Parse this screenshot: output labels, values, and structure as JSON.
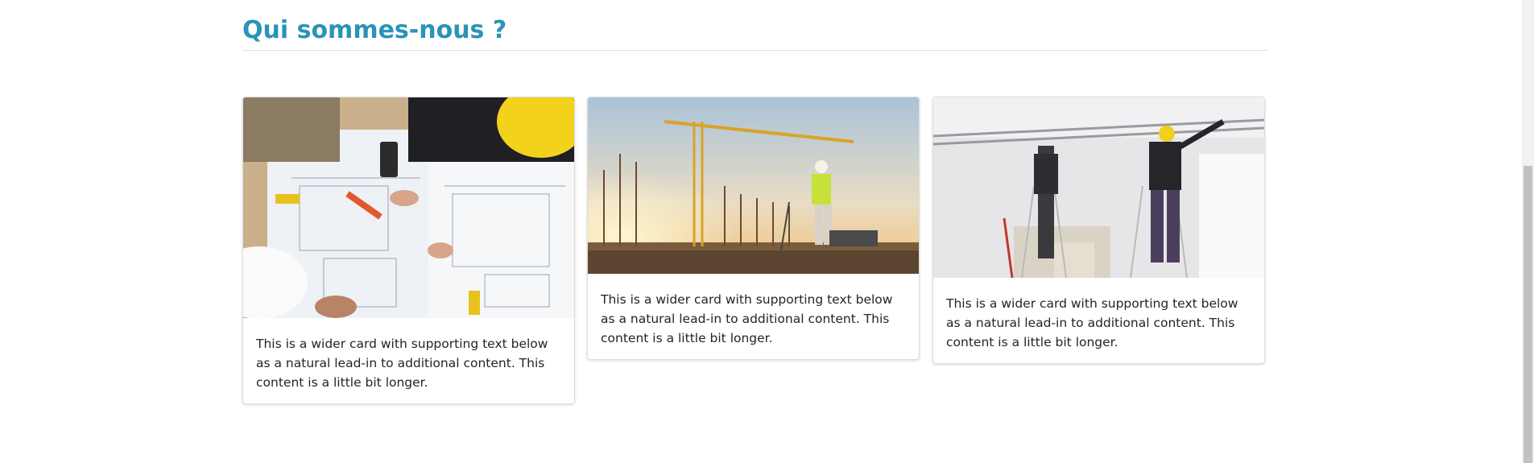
{
  "section": {
    "title": "Qui sommes-nous ?"
  },
  "cards": [
    {
      "text": "This is a wider card with supporting text below as a natural lead-in to additional content. This content is a little bit longer.",
      "image": "architects-blueprints-photo"
    },
    {
      "text": "This is a wider card with supporting text below as a natural lead-in to additional content. This content is a little bit longer.",
      "image": "construction-site-crane-photo"
    },
    {
      "text": "This is a wider card with supporting text below as a natural lead-in to additional content. This content is a little bit longer.",
      "image": "drywall-ceiling-workers-photo"
    }
  ],
  "colors": {
    "title": "#2a93b8",
    "text": "#212529",
    "border": "#dee2e6"
  }
}
